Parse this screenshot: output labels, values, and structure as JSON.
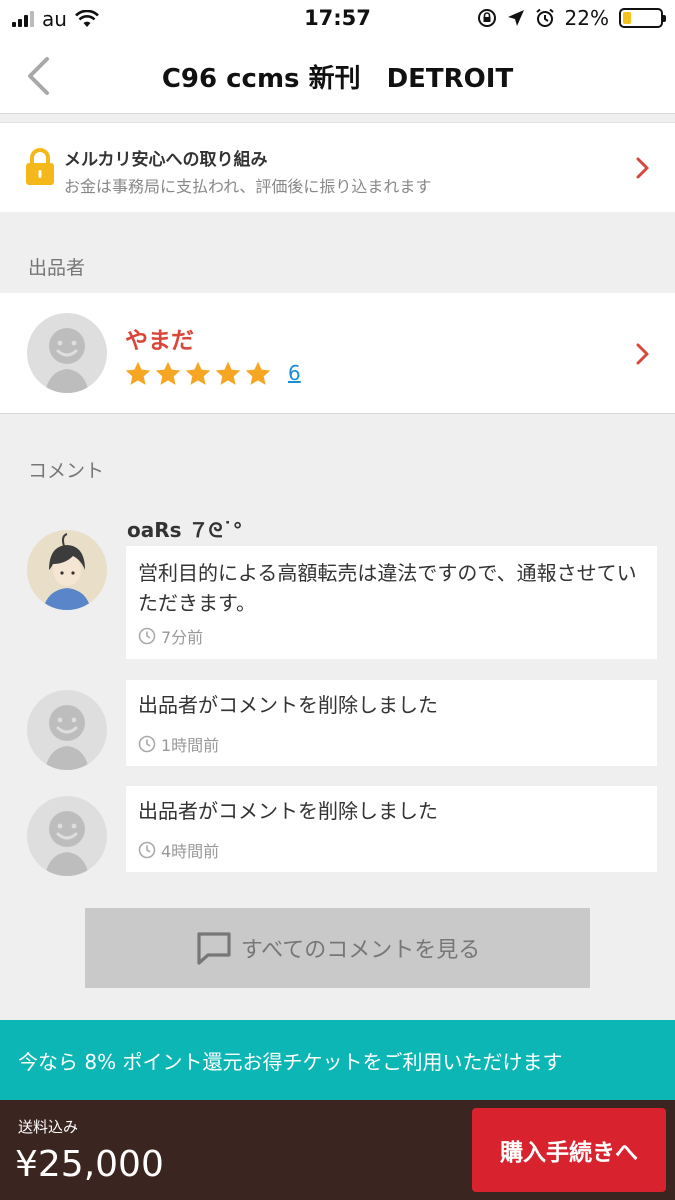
{
  "status_bar": {
    "carrier": "au",
    "time": "17:57",
    "battery": "22%",
    "battery_level": 0.22
  },
  "nav": {
    "title": "C96 ccms 新刊　DETROIT"
  },
  "safety": {
    "title": "メルカリ安心への取り組み",
    "subtitle": "お金は事務局に支払われ、評価後に振り込まれます"
  },
  "seller_section": {
    "label": "出品者"
  },
  "seller": {
    "name": "やまだ",
    "stars": 5,
    "rating_count": "6"
  },
  "comments_section": {
    "label": "コメント"
  },
  "comments": [
    {
      "user": "oaRs ７ᘓ˙°",
      "text": "営利目的による高額転売は違法ですので、通報させていただきます。",
      "time": "7分前"
    },
    {
      "text": "出品者がコメントを削除しました",
      "time": "1時間前"
    },
    {
      "text": "出品者がコメントを削除しました",
      "time": "4時間前"
    }
  ],
  "all_comments_button": {
    "label": "すべてのコメントを見る"
  },
  "points_banner": {
    "text": "今なら 8% ポイント還元お得チケットをご利用いただけます"
  },
  "purchase": {
    "shipping_label": "送料込み",
    "price": "¥25,000",
    "button_label": "購入手続きへ"
  },
  "colors": {
    "accent_red": "#d9473a",
    "buy_red": "#d8232f",
    "teal": "#0cb6b5",
    "star": "#f6a623",
    "link": "#1b8ed8"
  }
}
